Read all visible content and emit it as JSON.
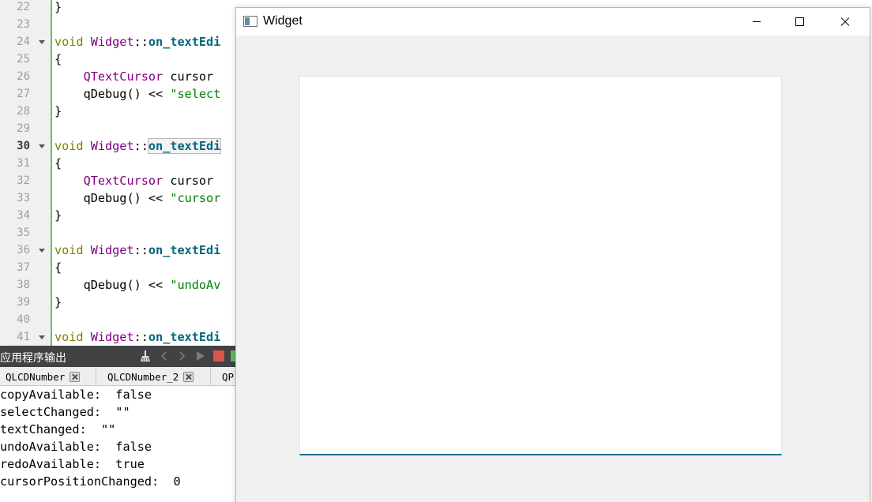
{
  "editor": {
    "line_numbers": [
      "22",
      "23",
      "24",
      "25",
      "26",
      "27",
      "28",
      "29",
      "30",
      "31",
      "32",
      "33",
      "34",
      "35",
      "36",
      "37",
      "38",
      "39",
      "40",
      "41"
    ],
    "current_line": "30",
    "lines": {
      "l22": {
        "brace": "}"
      },
      "l24": {
        "kw": "void",
        "cls": "Widget",
        "sep": "::",
        "fn": "on_textEdi"
      },
      "l25": {
        "brace": "{"
      },
      "l26": {
        "type": "QTextCursor",
        "rest": " cursor"
      },
      "l27": {
        "fn": "qDebug",
        "call": "() << ",
        "str": "\"select"
      },
      "l28": {
        "brace": "}"
      },
      "l30": {
        "kw": "void",
        "cls": "Widget",
        "sep": "::",
        "fn": "on_textEdi"
      },
      "l31": {
        "brace": "{"
      },
      "l32": {
        "type": "QTextCursor",
        "rest": " cursor"
      },
      "l33": {
        "fn": "qDebug",
        "call": "() << ",
        "str": "\"cursor"
      },
      "l34": {
        "brace": "}"
      },
      "l36": {
        "kw": "void",
        "cls": "Widget",
        "sep": "::",
        "fn": "on_textEdi"
      },
      "l37": {
        "brace": "{"
      },
      "l38": {
        "fn": "qDebug",
        "call": "() << ",
        "str": "\"undoAv"
      },
      "l39": {
        "brace": "}"
      },
      "l41": {
        "kw": "void",
        "cls": "Widget",
        "sep": "::",
        "fn": "on_textEdi"
      }
    }
  },
  "output_pane": {
    "title": "应用程序输出",
    "tabs": [
      {
        "label": "QLCDNumber"
      },
      {
        "label": "QLCDNumber_2"
      },
      {
        "label": "QP"
      }
    ],
    "lines": [
      "copyAvailable:  false",
      "selectChanged:  \"\"",
      "textChanged:  \"\"",
      "undoAvailable:  false",
      "redoAvailable:  true",
      "cursorPositionChanged:  0"
    ],
    "colors": {
      "header_bg": "#404244",
      "stop": "#d9534f",
      "run": "#5cb85c"
    }
  },
  "widget_window": {
    "title": "Widget",
    "icons": [
      "app-window-icon",
      "minimize-icon",
      "maximize-icon",
      "close-icon"
    ],
    "colors": {
      "textedit_focus": "#1f6f8f"
    }
  }
}
